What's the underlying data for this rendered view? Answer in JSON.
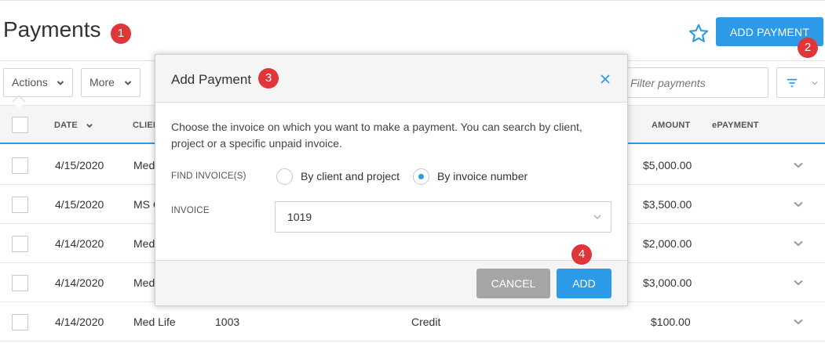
{
  "page": {
    "title": "Payments"
  },
  "badges": [
    "1",
    "2",
    "3",
    "4"
  ],
  "header": {
    "add_payment_label": "ADD PAYMENT"
  },
  "toolbar": {
    "actions_label": "Actions",
    "more_label": "More",
    "filter_placeholder": "Filter payments"
  },
  "table": {
    "columns": {
      "date": "DATE",
      "client": "CLIENT",
      "amount": "AMOUNT",
      "epayment": "ePAYMENT"
    },
    "rows": [
      {
        "date": "4/15/2020",
        "client": "Med",
        "invoice": "",
        "method": "",
        "amount": "$5,000.00"
      },
      {
        "date": "4/15/2020",
        "client": "MS C",
        "invoice": "",
        "method": "",
        "amount": "$3,500.00"
      },
      {
        "date": "4/14/2020",
        "client": "Med",
        "invoice": "",
        "method": "",
        "amount": "$2,000.00"
      },
      {
        "date": "4/14/2020",
        "client": "Med",
        "invoice": "",
        "method": "",
        "amount": "$3,000.00"
      },
      {
        "date": "4/14/2020",
        "client": "Med Life",
        "invoice": "1003",
        "method": "Credit",
        "amount": "$100.00"
      }
    ]
  },
  "modal": {
    "title": "Add Payment",
    "description": "Choose the invoice on which you want to make a payment. You can search by client, project or a specific unpaid invoice.",
    "find_label": "FIND INVOICE(S)",
    "option_client": "By client and project",
    "option_invoice": "By invoice number",
    "selected_option": "By invoice number",
    "invoice_label": "INVOICE",
    "invoice_value": "1019",
    "cancel_label": "CANCEL",
    "add_label": "ADD"
  },
  "colors": {
    "accent": "#2d9ae8",
    "badge": "#e0363a",
    "cancel": "#a4a5a6"
  }
}
